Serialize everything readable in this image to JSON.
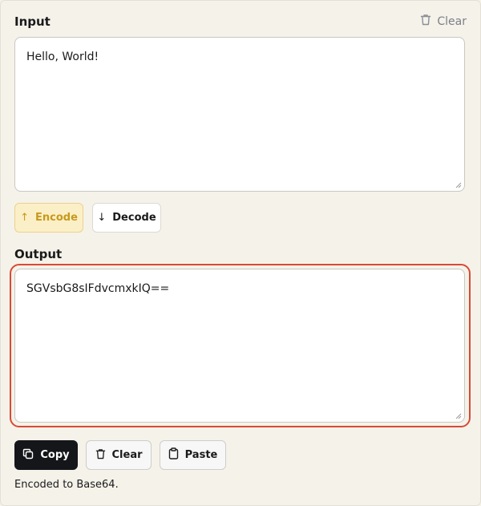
{
  "input": {
    "title": "Input",
    "clear_label": "Clear",
    "value": "Hello, World!"
  },
  "actions": {
    "encode_label": "Encode",
    "decode_label": "Decode",
    "encode_icon": "arrow-up-icon",
    "decode_icon": "arrow-down-icon"
  },
  "output": {
    "title": "Output",
    "value": "SGVsbG8sIFdvcmxkIQ=="
  },
  "output_actions": {
    "copy_label": "Copy",
    "clear_label": "Clear",
    "paste_label": "Paste"
  },
  "status_text": "Encoded to Base64.",
  "colors": {
    "highlight": "#d84a35",
    "encode_accent": "#c79a1d",
    "copy_bg": "#14161a"
  }
}
